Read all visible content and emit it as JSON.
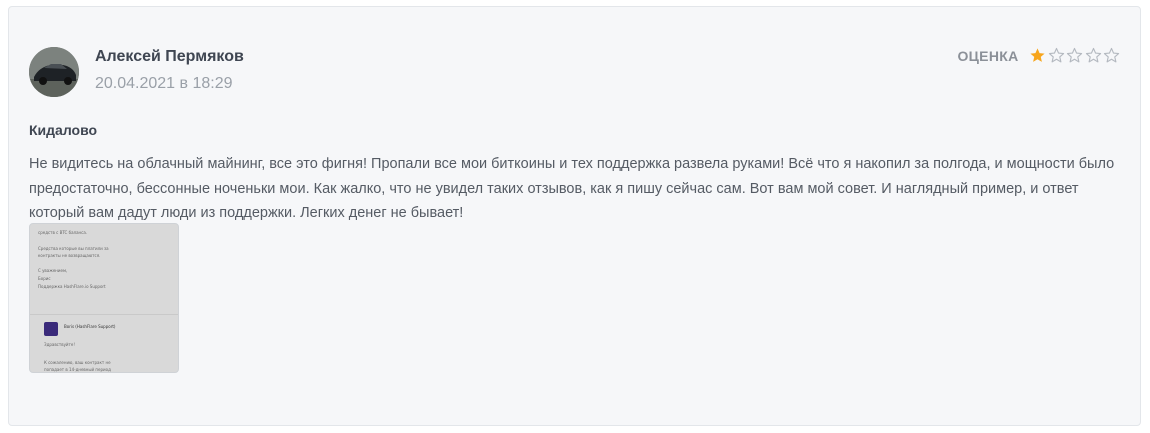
{
  "review": {
    "author": "Алексей Пермяков",
    "date": "20.04.2021 в 18:29",
    "rating_label": "ОЦЕНКА",
    "rating_value": 1,
    "rating_max": 5,
    "title": "Кидалово",
    "text": "Не видитесь на облачный майнинг, все это фигня! Пропали все мои биткоины и тех поддержка развела руками! Всё что я накопил за полгода, и мощности было предостаточно, бессонные ноченьки мои. Как жалко, что не увидел таких отзывов, как я пишу сейчас сам. Вот вам мой совет. И наглядный пример, и ответ который вам дадут люди из поддержки. Легких денег не бывает!",
    "attachment": {
      "lines_top": [
        "средств с BTC баланса.",
        "Средства которые вы платили за",
        "контракты не возвращаются.",
        "С уважением,",
        "Борис",
        "Поддержка HashFlare.io Support"
      ],
      "sender": "Boris (HashFlare Support)",
      "lines_bottom": [
        "Здравствуйте!",
        "К сожалению, ваш контракт не",
        "попадает в 14-дневный период"
      ]
    }
  },
  "colors": {
    "star_filled": "#f7a51c",
    "star_empty": "#b4b9c0",
    "card_bg": "#f6f7f9"
  }
}
